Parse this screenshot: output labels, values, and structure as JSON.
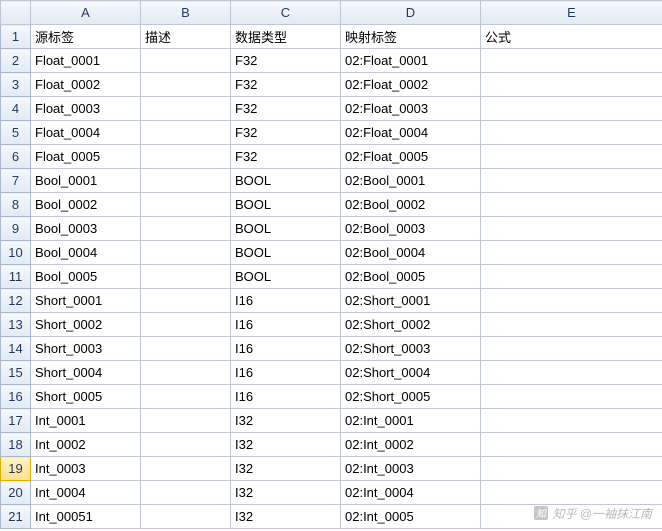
{
  "columns": [
    "A",
    "B",
    "C",
    "D",
    "E"
  ],
  "headers": {
    "A": "源标签",
    "B": "描述",
    "C": "数据类型",
    "D": "映射标签",
    "E": "公式"
  },
  "selected_row": 19,
  "rows": [
    {
      "n": 1,
      "A": "源标签",
      "B": "描述",
      "C": "数据类型",
      "D": "映射标签",
      "E": "公式"
    },
    {
      "n": 2,
      "A": "Float_0001",
      "B": "",
      "C": "F32",
      "D": "02:Float_0001",
      "E": ""
    },
    {
      "n": 3,
      "A": "Float_0002",
      "B": "",
      "C": "F32",
      "D": "02:Float_0002",
      "E": ""
    },
    {
      "n": 4,
      "A": "Float_0003",
      "B": "",
      "C": "F32",
      "D": "02:Float_0003",
      "E": ""
    },
    {
      "n": 5,
      "A": "Float_0004",
      "B": "",
      "C": "F32",
      "D": "02:Float_0004",
      "E": ""
    },
    {
      "n": 6,
      "A": "Float_0005",
      "B": "",
      "C": "F32",
      "D": "02:Float_0005",
      "E": ""
    },
    {
      "n": 7,
      "A": "Bool_0001",
      "B": "",
      "C": "BOOL",
      "D": "02:Bool_0001",
      "E": ""
    },
    {
      "n": 8,
      "A": "Bool_0002",
      "B": "",
      "C": "BOOL",
      "D": "02:Bool_0002",
      "E": ""
    },
    {
      "n": 9,
      "A": "Bool_0003",
      "B": "",
      "C": "BOOL",
      "D": "02:Bool_0003",
      "E": ""
    },
    {
      "n": 10,
      "A": "Bool_0004",
      "B": "",
      "C": "BOOL",
      "D": "02:Bool_0004",
      "E": ""
    },
    {
      "n": 11,
      "A": "Bool_0005",
      "B": "",
      "C": "BOOL",
      "D": "02:Bool_0005",
      "E": ""
    },
    {
      "n": 12,
      "A": "Short_0001",
      "B": "",
      "C": "I16",
      "D": "02:Short_0001",
      "E": ""
    },
    {
      "n": 13,
      "A": "Short_0002",
      "B": "",
      "C": "I16",
      "D": "02:Short_0002",
      "E": ""
    },
    {
      "n": 14,
      "A": "Short_0003",
      "B": "",
      "C": "I16",
      "D": "02:Short_0003",
      "E": ""
    },
    {
      "n": 15,
      "A": "Short_0004",
      "B": "",
      "C": "I16",
      "D": "02:Short_0004",
      "E": ""
    },
    {
      "n": 16,
      "A": "Short_0005",
      "B": "",
      "C": "I16",
      "D": "02:Short_0005",
      "E": ""
    },
    {
      "n": 17,
      "A": "Int_0001",
      "B": "",
      "C": "I32",
      "D": "02:Int_0001",
      "E": ""
    },
    {
      "n": 18,
      "A": "Int_0002",
      "B": "",
      "C": "I32",
      "D": "02:Int_0002",
      "E": ""
    },
    {
      "n": 19,
      "A": "Int_0003",
      "B": "",
      "C": "I32",
      "D": "02:Int_0003",
      "E": ""
    },
    {
      "n": 20,
      "A": "Int_0004",
      "B": "",
      "C": "I32",
      "D": "02:Int_0004",
      "E": ""
    },
    {
      "n": 21,
      "A": "Int_00051",
      "B": "",
      "C": "I32",
      "D": "02:Int_0005",
      "E": ""
    }
  ],
  "watermark": "知乎 @一袖抹江南"
}
